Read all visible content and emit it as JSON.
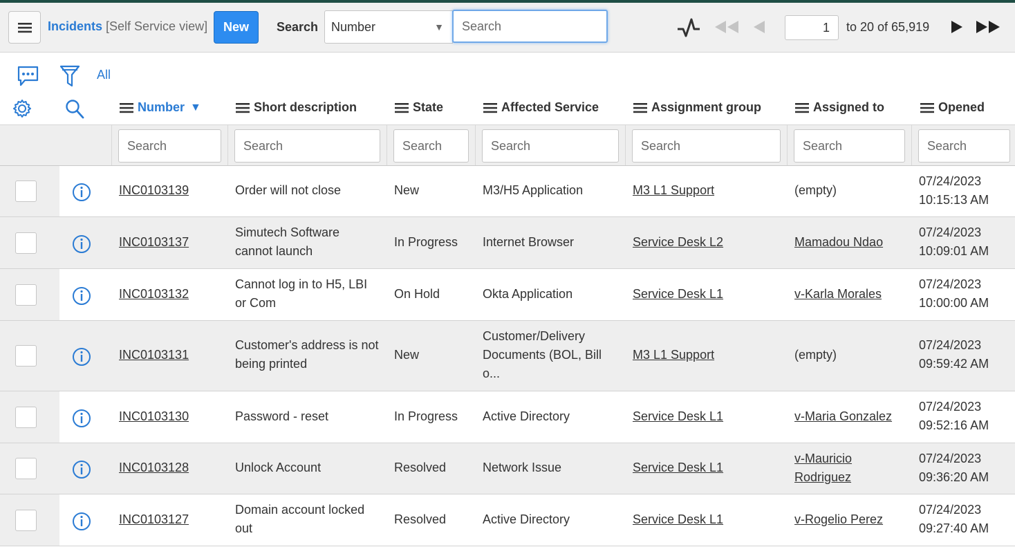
{
  "header": {
    "title": "Incidents",
    "view": "[Self Service view]",
    "new_label": "New",
    "search_label": "Search",
    "search_field": "Number",
    "search_placeholder": "Search",
    "page_current": "1",
    "page_range": "to 20 of 65,919"
  },
  "toolbar": {
    "all_label": "All"
  },
  "columns": [
    {
      "label": "Number",
      "sorted": true
    },
    {
      "label": "Short description"
    },
    {
      "label": "State"
    },
    {
      "label": "Affected Service"
    },
    {
      "label": "Assignment group"
    },
    {
      "label": "Assigned to"
    },
    {
      "label": "Opened"
    }
  ],
  "filters": {
    "placeholder": "Search"
  },
  "rows": [
    {
      "number": "INC0103139",
      "desc1": "Order will not close",
      "desc2": "",
      "state": "New",
      "service1": "M3/H5 Application",
      "service2": "",
      "service3": "",
      "group": "M3 L1 Support",
      "assigned1": "(empty)",
      "assigned2": "",
      "date": "07/24/2023",
      "time": "10:15:13 AM"
    },
    {
      "number": "INC0103137",
      "desc1": "Simutech Software",
      "desc2": "cannot launch",
      "state": "In Progress",
      "service1": "Internet Browser",
      "service2": "",
      "service3": "",
      "group": "Service Desk L2",
      "assigned1": "Mamadou Ndao",
      "assigned2": "",
      "date": "07/24/2023",
      "time": "10:09:01 AM"
    },
    {
      "number": "INC0103132",
      "desc1": "Cannot log in to H5, LBI",
      "desc2": "or Com",
      "state": "On Hold",
      "service1": "Okta Application",
      "service2": "",
      "service3": "",
      "group": "Service Desk L1",
      "assigned1": "v-Karla Morales",
      "assigned2": "",
      "date": "07/24/2023",
      "time": "10:00:00 AM"
    },
    {
      "number": "INC0103131",
      "desc1": "Customer's address is not",
      "desc2": "being printed",
      "state": "New",
      "service1": "Customer/Delivery",
      "service2": "Documents (BOL, Bill",
      "service3": "o...",
      "group": "M3 L1 Support",
      "assigned1": "(empty)",
      "assigned2": "",
      "date": "07/24/2023",
      "time": "09:59:42 AM"
    },
    {
      "number": "INC0103130",
      "desc1": "Password - reset",
      "desc2": "",
      "state": "In Progress",
      "service1": "Active Directory",
      "service2": "",
      "service3": "",
      "group": "Service Desk L1",
      "assigned1": "v-Maria Gonzalez",
      "assigned2": "",
      "date": "07/24/2023",
      "time": "09:52:16 AM"
    },
    {
      "number": "INC0103128",
      "desc1": "Unlock Account",
      "desc2": "",
      "state": "Resolved",
      "service1": "Network Issue",
      "service2": "",
      "service3": "",
      "group": "Service Desk L1",
      "assigned1": "v-Mauricio",
      "assigned2": "Rodriguez",
      "date": "07/24/2023",
      "time": "09:36:20 AM"
    },
    {
      "number": "INC0103127",
      "desc1": "Domain account locked",
      "desc2": "out",
      "state": "Resolved",
      "service1": "Active Directory",
      "service2": "",
      "service3": "",
      "group": "Service Desk L1",
      "assigned1": "v-Rogelio Perez",
      "assigned2": "",
      "date": "07/24/2023",
      "time": "09:27:40 AM"
    }
  ]
}
